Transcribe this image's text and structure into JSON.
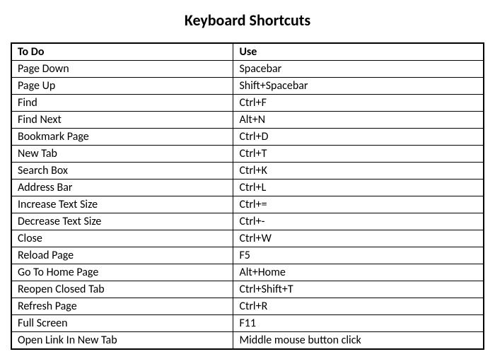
{
  "title": "Keyboard Shortcuts",
  "headers": {
    "action": "To Do",
    "shortcut": "Use"
  },
  "rows": [
    {
      "action": "Page Down",
      "shortcut": "Spacebar"
    },
    {
      "action": "Page Up",
      "shortcut": "Shift+Spacebar"
    },
    {
      "action": "Find",
      "shortcut": "Ctrl+F"
    },
    {
      "action": "Find Next",
      "shortcut": "Alt+N"
    },
    {
      "action": "Bookmark Page",
      "shortcut": "Ctrl+D"
    },
    {
      "action": "New Tab",
      "shortcut": "Ctrl+T"
    },
    {
      "action": "Search Box",
      "shortcut": "Ctrl+K"
    },
    {
      "action": "Address Bar",
      "shortcut": "Ctrl+L"
    },
    {
      "action": "Increase Text Size",
      "shortcut": "Ctrl+="
    },
    {
      "action": "Decrease Text Size",
      "shortcut": "Ctrl+-"
    },
    {
      "action": "Close",
      "shortcut": "Ctrl+W"
    },
    {
      "action": "Reload Page",
      "shortcut": "F5"
    },
    {
      "action": "Go To Home Page",
      "shortcut": "Alt+Home"
    },
    {
      "action": "Reopen Closed Tab",
      "shortcut": "Ctrl+Shift+T"
    },
    {
      "action": "Refresh Page",
      "shortcut": "Ctrl+R"
    },
    {
      "action": "Full Screen",
      "shortcut": "F11"
    },
    {
      "action": "Open Link In New Tab",
      "shortcut": "Middle mouse button click"
    }
  ]
}
